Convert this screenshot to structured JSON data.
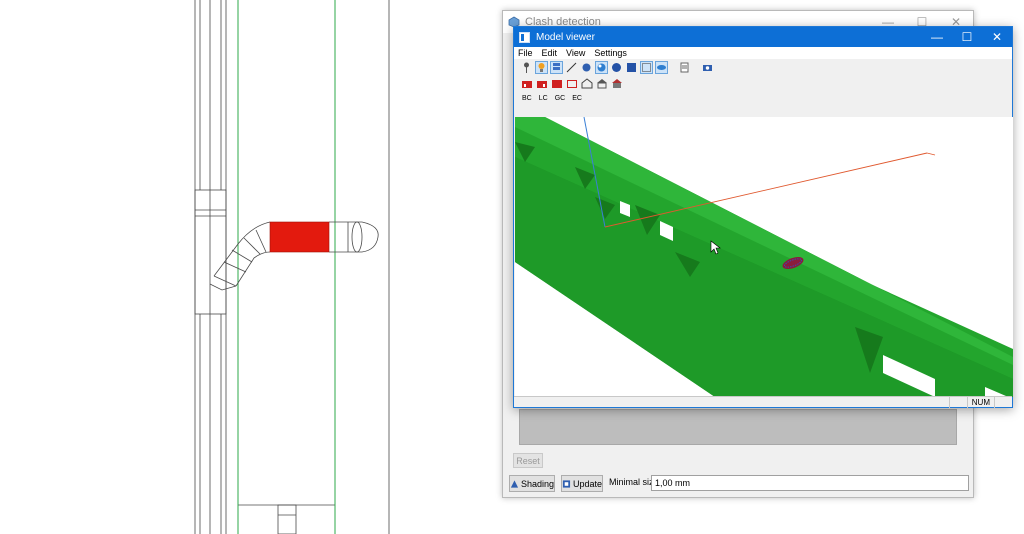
{
  "clash_window": {
    "title": "Clash detection",
    "controls": {
      "minimize": "—",
      "maximize": "☐",
      "close": "✕"
    },
    "reset_label": "Reset",
    "shading_label": "Shading",
    "update_label": "Update",
    "min_size_label": "Minimal size",
    "min_size_value": "1,00 mm"
  },
  "model_viewer": {
    "title": "Model viewer",
    "controls": {
      "minimize": "—",
      "maximize": "☐",
      "close": "✕"
    },
    "menu": [
      "File",
      "Edit",
      "View",
      "Settings"
    ],
    "text_tools": [
      "BC",
      "LC",
      "GC",
      "EC"
    ],
    "status": {
      "num": "NUM"
    }
  },
  "icons": {
    "row1": [
      "pin-icon",
      "lamp-icon",
      "stack-icon",
      "line-icon",
      "sphere-icon",
      "cube-shade-icon",
      "circle-icon",
      "square-icon",
      "bbox-icon",
      "eye-icon",
      "page-icon",
      "camera-icon"
    ],
    "row2": [
      "red-house-icon",
      "red-house-2-icon",
      "red-box-icon",
      "red-outline-icon",
      "house-outline-icon",
      "house-roof-icon",
      "house-tiles-icon"
    ]
  },
  "colors": {
    "clash": "#e31a0e",
    "beam_green": "#1f9e2a",
    "title_blue": "#0d6fd6",
    "axis_red": "#e0592f",
    "axis_blue": "#3a7fd5"
  }
}
